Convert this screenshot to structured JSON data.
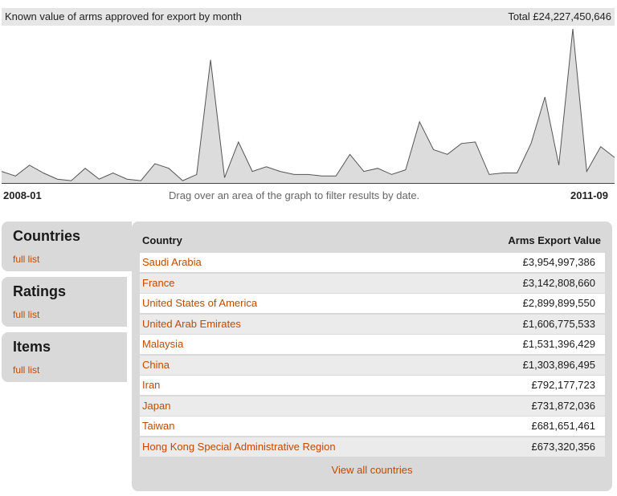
{
  "chart": {
    "title": "Known value of arms approved for export by month",
    "total": "Total £24,227,450,646",
    "start_label": "2008-01",
    "end_label": "2011-09",
    "hint": "Drag over an area of the graph to filter results by date."
  },
  "chart_data": {
    "type": "area",
    "x_start": "2008-01",
    "x_end": "2011-09",
    "values": [
      8,
      5,
      12,
      7,
      3,
      2,
      10,
      3,
      7,
      3,
      2,
      13,
      10,
      2,
      6,
      80,
      4,
      27,
      8,
      11,
      8,
      6,
      6,
      5,
      5,
      19,
      8,
      10,
      6,
      9,
      40,
      22,
      19,
      26,
      27,
      6,
      7,
      7,
      26,
      56,
      12,
      100,
      8,
      24,
      17
    ],
    "colors": {
      "fill": "#dcdcdc",
      "stroke": "#555555"
    }
  },
  "tabs": [
    {
      "title": "Countries",
      "link": "full list"
    },
    {
      "title": "Ratings",
      "link": "full list"
    },
    {
      "title": "Items",
      "link": "full list"
    }
  ],
  "table": {
    "headers": {
      "country": "Country",
      "value": "Arms Export Value"
    },
    "rows": [
      {
        "country": "Saudi Arabia",
        "value": "£3,954,997,386"
      },
      {
        "country": "France",
        "value": "£3,142,808,660"
      },
      {
        "country": "United States of America",
        "value": "£2,899,899,550"
      },
      {
        "country": "United Arab Emirates",
        "value": "£1,606,775,533"
      },
      {
        "country": "Malaysia",
        "value": "£1,531,396,429"
      },
      {
        "country": "China",
        "value": "£1,303,896,495"
      },
      {
        "country": "Iran",
        "value": "£792,177,723"
      },
      {
        "country": "Japan",
        "value": "£731,872,036"
      },
      {
        "country": "Taiwan",
        "value": "£681,651,461"
      },
      {
        "country": "Hong Kong Special Administrative Region",
        "value": "£673,320,356"
      }
    ],
    "view_all": "View all countries"
  },
  "colors": {
    "link": "#c04a00",
    "panel": "#d9d9d9"
  }
}
